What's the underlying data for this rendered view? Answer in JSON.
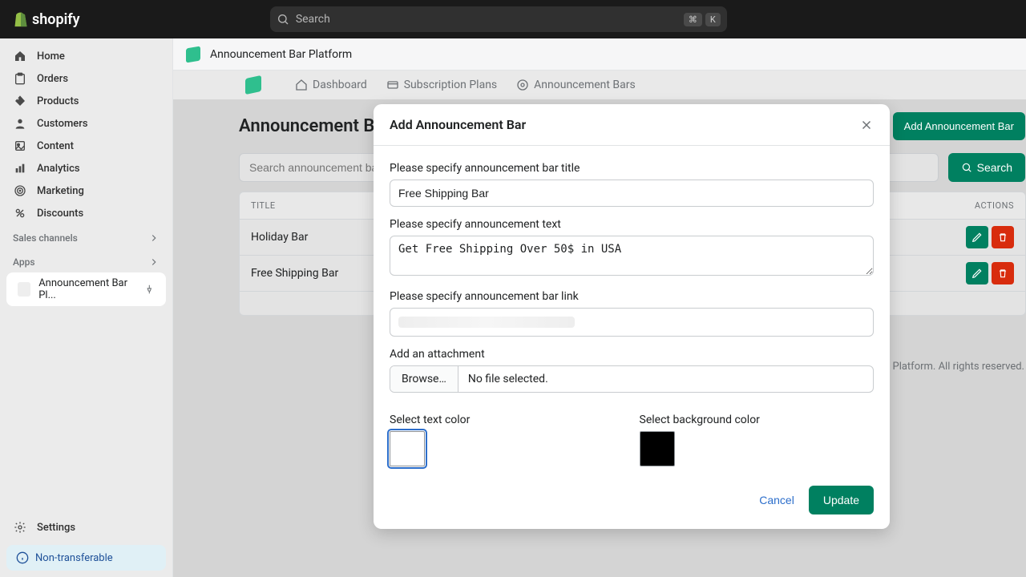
{
  "topbar": {
    "brand": "shopify",
    "search_placeholder": "Search",
    "kbd1": "⌘",
    "kbd2": "K"
  },
  "sidebar": {
    "items": [
      {
        "label": "Home"
      },
      {
        "label": "Orders"
      },
      {
        "label": "Products"
      },
      {
        "label": "Customers"
      },
      {
        "label": "Content"
      },
      {
        "label": "Analytics"
      },
      {
        "label": "Marketing"
      },
      {
        "label": "Discounts"
      }
    ],
    "sales_channels_label": "Sales channels",
    "apps_label": "Apps",
    "app_item": "Announcement Bar Pl...",
    "settings_label": "Settings",
    "nontransferable_label": "Non-transferable"
  },
  "app": {
    "header_title": "Announcement Bar Platform",
    "nav": {
      "dashboard": "Dashboard",
      "subscription": "Subscription Plans",
      "bars": "Announcement Bars"
    },
    "page": {
      "title": "Announcement Bars",
      "add_button": "Add Announcement Bar",
      "search_placeholder": "Search announcement bar",
      "search_button": "Search",
      "table": {
        "col_title": "Title",
        "col_actions": "Actions",
        "rows": [
          {
            "title": "Holiday Bar"
          },
          {
            "title": "Free Shipping Bar"
          }
        ]
      },
      "footer": "Platform. All rights reserved."
    }
  },
  "modal": {
    "title": "Add Announcement Bar",
    "labels": {
      "title": "Please specify announcement bar title",
      "text": "Please specify announcement text",
      "link": "Please specify announcement bar link",
      "attachment": "Add an attachment",
      "browse": "Browse…",
      "nofile": "No file selected.",
      "textcolor": "Select text color",
      "bgcolor": "Select background color"
    },
    "values": {
      "title": "Free Shipping Bar",
      "text": "Get Free Shipping Over 50$ in USA"
    },
    "colors": {
      "text": "#ffffff",
      "background": "#000000"
    },
    "buttons": {
      "cancel": "Cancel",
      "update": "Update"
    }
  }
}
